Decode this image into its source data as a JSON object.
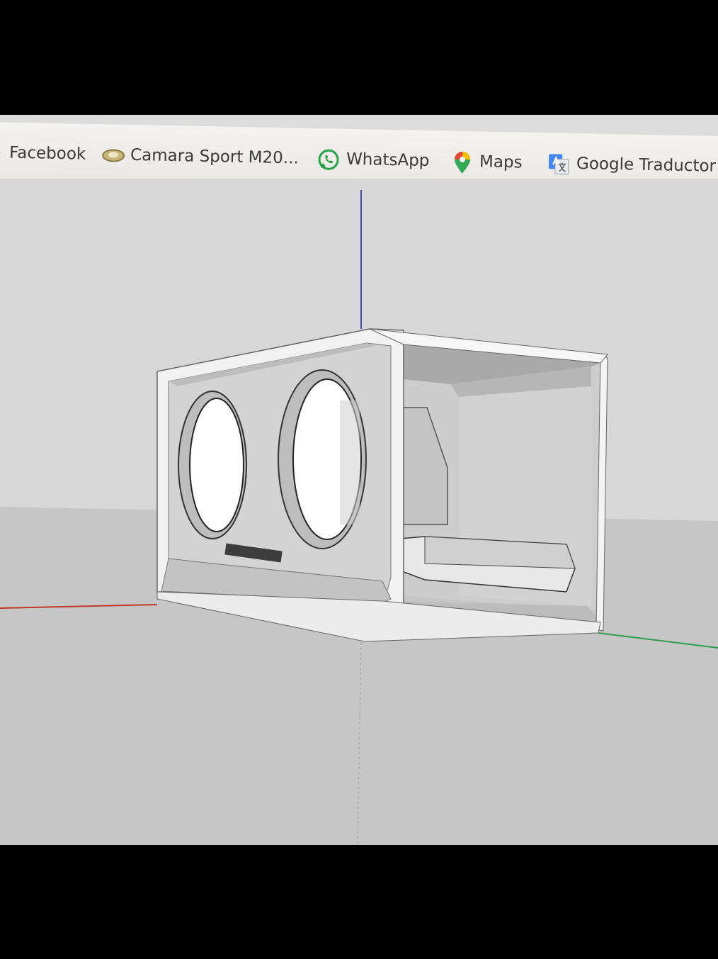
{
  "bookmarks": [
    {
      "label": "Facebook",
      "icon": "facebook-icon"
    },
    {
      "label": "Camara Sport M20...",
      "icon": "camera-icon"
    },
    {
      "label": "WhatsApp",
      "icon": "whatsapp-icon"
    },
    {
      "label": "Maps",
      "icon": "maps-pin-icon"
    },
    {
      "label": "Google Traductor",
      "icon": "google-translate-icon"
    }
  ],
  "colors": {
    "bar": "#eeede9",
    "sky": "#d9d9d9",
    "ground": "#c9c9c9",
    "panel": "#f2f2f2",
    "panel_shade": "#bdbdbd",
    "axis_red": "#c0392b",
    "axis_green": "#2e9d4e",
    "axis_blue": "#3d4fb0"
  }
}
